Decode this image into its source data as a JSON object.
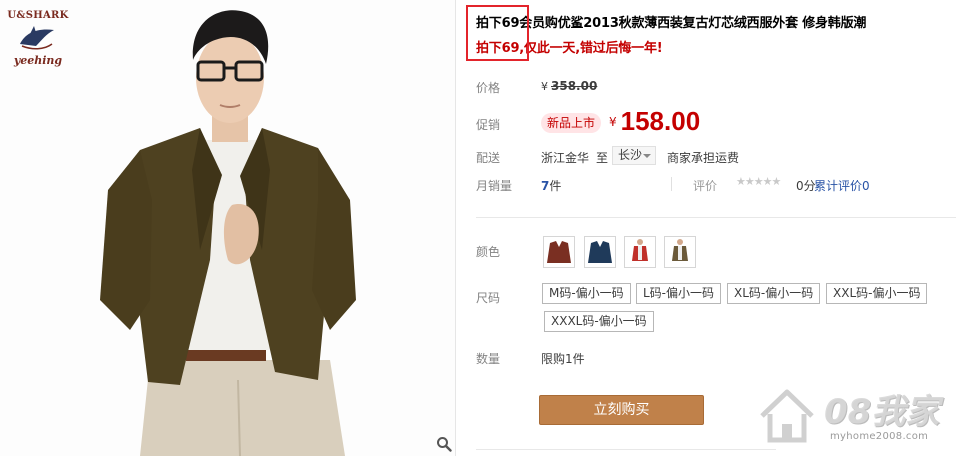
{
  "brand": {
    "line1": "U&SHARK",
    "line2": "yeehing"
  },
  "title": "拍下69会员购优鲨2013秋款薄西装复古灯芯绒西服外套 修身韩版潮",
  "subtitle": "拍下69,仅此一天,错过后悔一年!",
  "price": {
    "label": "价格",
    "currency": "¥",
    "value": "358.00"
  },
  "promo": {
    "label": "促销",
    "badge": "新品上市",
    "currency": "¥",
    "value": "158.00"
  },
  "shipping": {
    "label": "配送",
    "from": "浙江金华",
    "to_label": "至",
    "destination": "长沙",
    "fee": "商家承担运费"
  },
  "sales": {
    "label": "月销量",
    "count": "7",
    "unit": "件"
  },
  "rating": {
    "label": "评价",
    "stars": "★★★★★",
    "score": "0分",
    "review_link": "累计评价0"
  },
  "colors": {
    "label": "颜色",
    "swatch_colors": [
      "#7a2f22",
      "#1f3a5a",
      "#c0302a",
      "#6b5a3a"
    ]
  },
  "sizes": {
    "label": "尺码",
    "options": [
      "M码-偏小一码",
      "L码-偏小一码",
      "XL码-偏小一码",
      "XXL码-偏小一码",
      "XXXL码-偏小一码"
    ]
  },
  "quantity": {
    "label": "数量",
    "text": "限购1件"
  },
  "buy_button": "立刻购买",
  "watermark": {
    "text": "08我家",
    "url": "myhome2008.com"
  },
  "theme": {
    "accent_red": "#c40000",
    "link_blue": "#2953a6",
    "buy_button": "#c0814a",
    "highlight_box": "#e3242b"
  }
}
